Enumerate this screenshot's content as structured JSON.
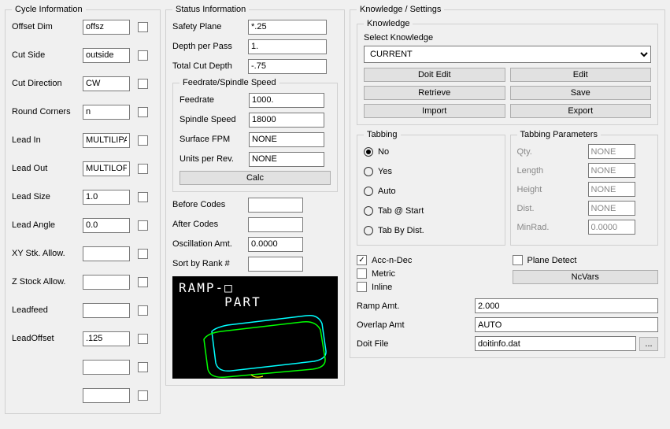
{
  "cycle": {
    "legend": "Cycle Information",
    "offset_dim": {
      "label": "Offset Dim",
      "value": "offsz"
    },
    "cut_side": {
      "label": "Cut Side",
      "value": "outside"
    },
    "cut_direction": {
      "label": "Cut Direction",
      "value": "CW"
    },
    "round_corners": {
      "label": "Round Corners",
      "value": "n"
    },
    "lead_in": {
      "label": "Lead In",
      "value": "MULTILIPA"
    },
    "lead_out": {
      "label": "Lead Out",
      "value": "MULTILOP"
    },
    "lead_size": {
      "label": "Lead Size",
      "value": "1.0"
    },
    "lead_angle": {
      "label": "Lead Angle",
      "value": "0.0"
    },
    "xy_stk": {
      "label": "XY Stk. Allow."
    },
    "z_stock": {
      "label": "Z Stock Allow."
    },
    "leadfeed": {
      "label": "Leadfeed"
    },
    "leadoffset": {
      "label": "LeadOffset",
      "value": ".125"
    }
  },
  "status": {
    "legend": "Status Information",
    "safety_plane": {
      "label": "Safety Plane",
      "value": "*.25"
    },
    "depth_per_pass": {
      "label": "Depth per Pass",
      "value": "1."
    },
    "total_cut_depth": {
      "label": "Total Cut Depth",
      "value": "-.75"
    },
    "feed_legend": "Feedrate/Spindle Speed",
    "feedrate": {
      "label": "Feedrate",
      "value": "1000."
    },
    "spindle_speed": {
      "label": "Spindle Speed",
      "value": "18000"
    },
    "surface_fpm": {
      "label": "Surface FPM",
      "value": "NONE"
    },
    "units_per_rev": {
      "label": "Units per Rev.",
      "value": "NONE"
    },
    "calc": "Calc",
    "before_codes": {
      "label": "Before Codes",
      "value": ""
    },
    "after_codes": {
      "label": "After Codes",
      "value": ""
    },
    "oscillation": {
      "label": "Oscillation Amt.",
      "value": "0.0000"
    },
    "sort_rank": {
      "label": "Sort by Rank #",
      "value": ""
    },
    "preview_text": "RAMP-□\n     PART"
  },
  "knowledge": {
    "legend": "Knowledge / Settings",
    "sub_legend": "Knowledge",
    "select_label": "Select Knowledge",
    "select_value": "CURRENT",
    "doit_edit": "Doit Edit",
    "edit": "Edit",
    "retrieve": "Retrieve",
    "save": "Save",
    "import": "Import",
    "export": "Export"
  },
  "tabbing": {
    "legend": "Tabbing",
    "no": "No",
    "yes": "Yes",
    "auto": "Auto",
    "tab_start": "Tab @ Start",
    "tab_dist": "Tab By Dist."
  },
  "tabparams": {
    "legend": "Tabbing Parameters",
    "qty": {
      "label": "Qty.",
      "value": "NONE"
    },
    "length": {
      "label": "Length",
      "value": "NONE"
    },
    "height": {
      "label": "Height",
      "value": "NONE"
    },
    "dist": {
      "label": "Dist.",
      "value": "NONE"
    },
    "minrad": {
      "label": "MinRad.",
      "value": "0.0000"
    }
  },
  "settings": {
    "acc_n_dec": "Acc-n-Dec",
    "metric": "Metric",
    "inline": "Inline",
    "plane_detect": "Plane Detect",
    "ncvars": "NcVars",
    "ramp_amt": {
      "label": "Ramp Amt.",
      "value": "2.000"
    },
    "overlap_amt": {
      "label": "Overlap Amt",
      "value": "AUTO"
    },
    "doit_file": {
      "label": "Doit File",
      "value": "doitinfo.dat"
    },
    "browse": "..."
  }
}
